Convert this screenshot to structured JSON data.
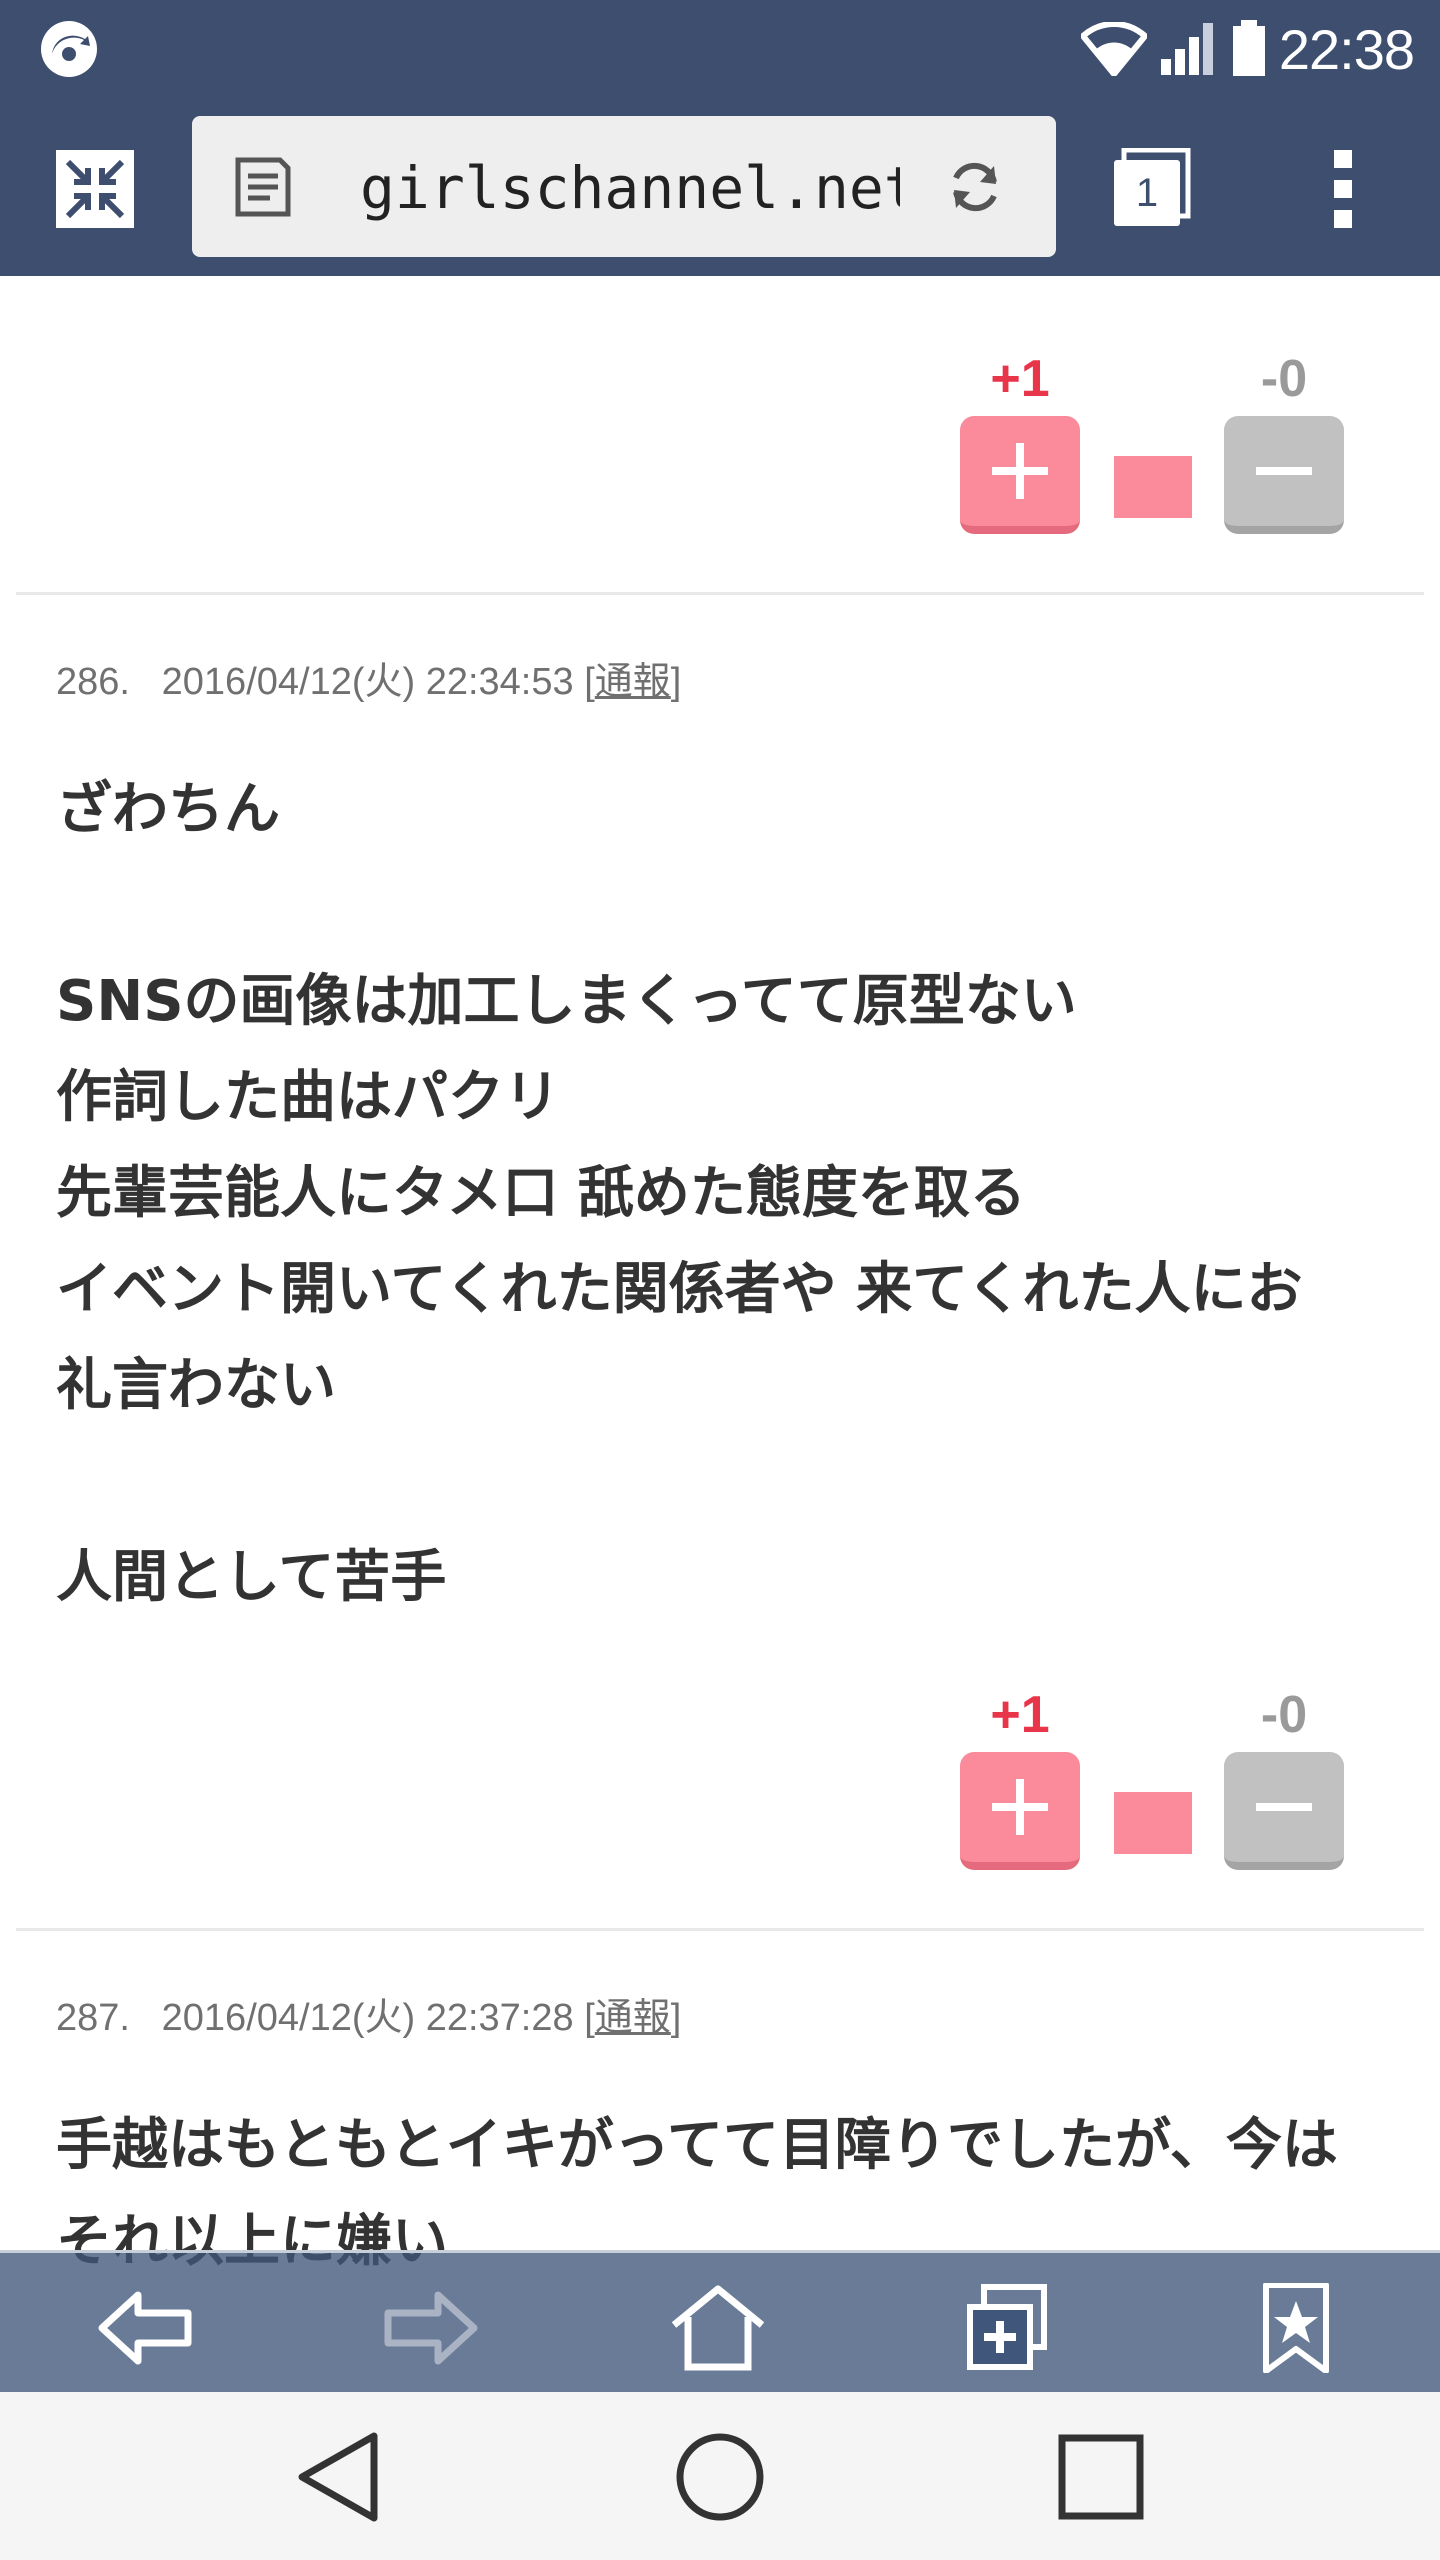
{
  "status_bar": {
    "time": "22:38",
    "icons": [
      "app-notification-icon",
      "wifi-icon",
      "cell-signal-icon",
      "battery-icon"
    ]
  },
  "toolbar": {
    "url": "girlschannel.net/",
    "tab_count": "1",
    "icons": [
      "shrink-screen-icon",
      "page-icon",
      "reload-icon",
      "tabs-icon",
      "more-vert-icon"
    ]
  },
  "top_votes": {
    "plus": "+1",
    "minus": "-0",
    "plus_ratio": 1.0
  },
  "comments": [
    {
      "number": "286.",
      "datetime": "2016/04/12(火) 22:34:53",
      "report_open": "[",
      "report_label": "通報",
      "report_close": "]",
      "lines": [
        "ざわちん",
        "",
        "SNSの画像は加工しまくってて原型ない",
        "作詞した曲はパクリ",
        "先輩芸能人にタメ口 舐めた態度を取る",
        "イベント開いてくれた関係者や 来てくれた人にお",
        "礼言わない",
        "",
        "人間として苦手"
      ],
      "votes": {
        "plus": "+1",
        "minus": "-0",
        "plus_ratio": 1.0
      }
    },
    {
      "number": "287.",
      "datetime": "2016/04/12(火) 22:37:28",
      "report_open": "[",
      "report_label": "通報",
      "report_close": "]",
      "lines": [
        "手越はもともとイキがってて目障りでしたが、今は",
        "それ以上に嫌い"
      ]
    }
  ],
  "bottom_nav": {
    "icons": [
      "back-arrow-icon",
      "forward-arrow-icon",
      "home-icon",
      "new-tab-icon",
      "bookmark-icon"
    ],
    "colors": {
      "active": "#ffffff",
      "disabled": "#a9b3c4"
    }
  },
  "system_nav": {
    "icons": [
      "back-triangle-icon",
      "home-circle-icon",
      "recents-square-icon"
    ]
  },
  "colors": {
    "header": "#3e4e6e",
    "plus": "#fb8a9b",
    "plus_text": "#e8354a",
    "minus": "#c1c1c1",
    "minus_text": "#9a9a9a",
    "body_text": "#333333",
    "meta_text": "#707070"
  }
}
